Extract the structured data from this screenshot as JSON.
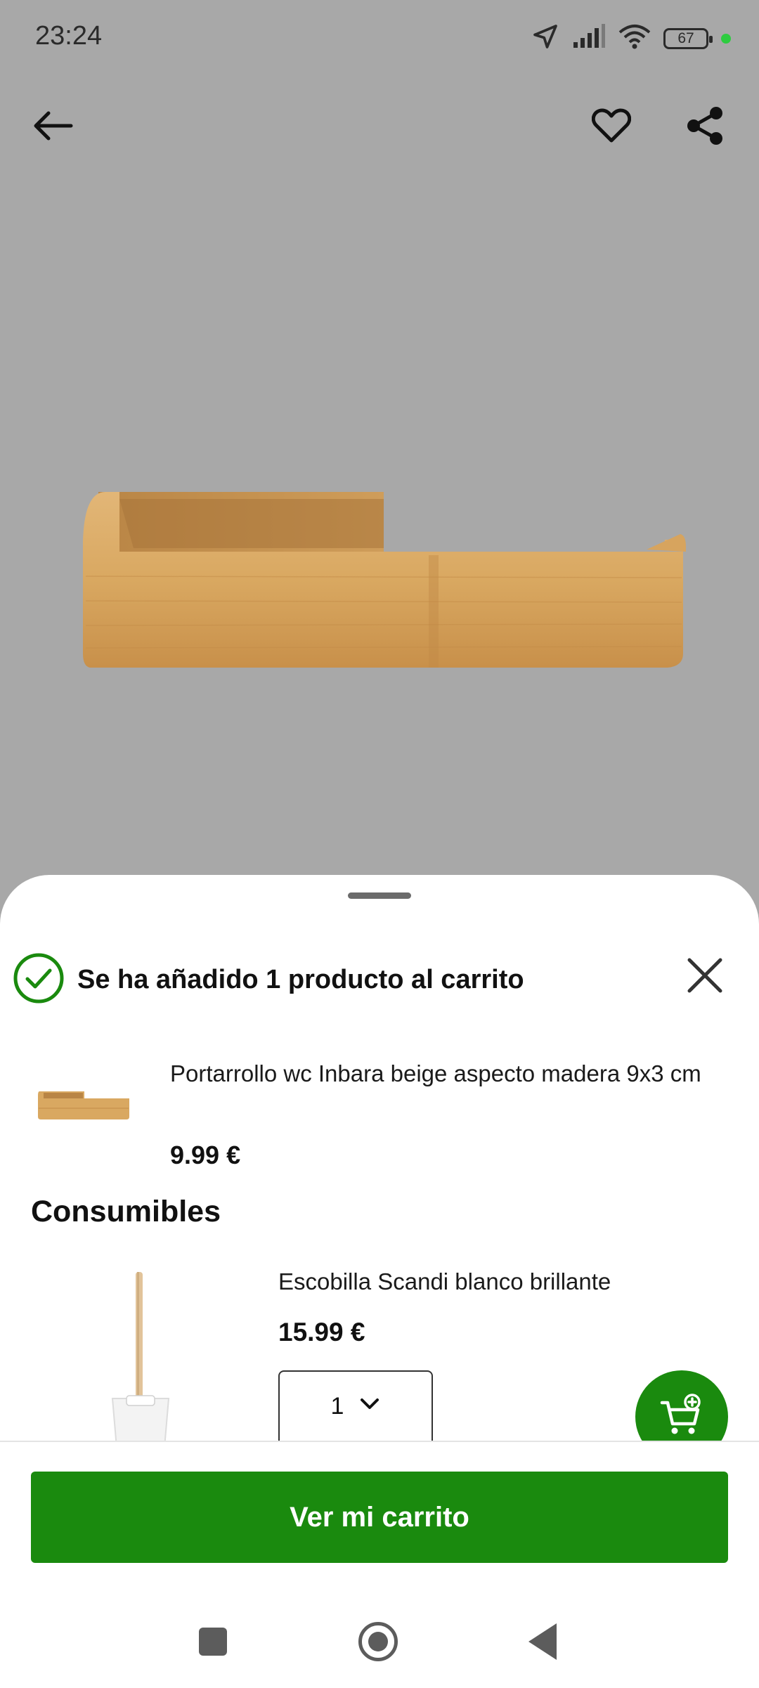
{
  "status_bar": {
    "time": "23:24",
    "battery_level": "67",
    "icons": [
      "location-arrow-icon",
      "signal-bars-icon",
      "wifi-icon",
      "battery-icon",
      "active-dot-icon"
    ]
  },
  "toolbar": {
    "icons": [
      "back-arrow-icon",
      "heart-icon",
      "share-icon"
    ]
  },
  "sheet": {
    "success_message": "Se ha añadido 1 producto al carrito",
    "added_product": {
      "name": "Portarrollo wc Inbara beige aspecto madera 9x3 cm",
      "price": "9.99 €"
    },
    "section_title": "Consumibles",
    "recommended_product": {
      "name": "Escobilla Scandi blanco brillante",
      "price": "15.99 €",
      "quantity": "1"
    }
  },
  "action_bar": {
    "cta_label": "Ver mi carrito"
  },
  "colors": {
    "accent_green": "#1a8a0e",
    "check_green": "#1a8a0e",
    "overlay_gray": "#a8a8a8"
  }
}
